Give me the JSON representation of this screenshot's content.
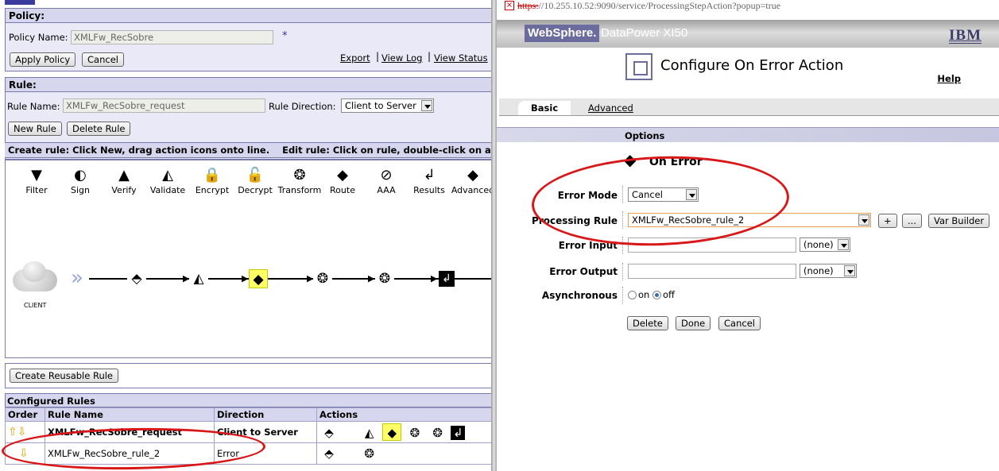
{
  "popup": {
    "url_strike": "https:",
    "url_rest": "//10.255.10.52:9090/service/ProcessingStepAction?popup=true",
    "brand_websphere": "WebSphere.",
    "brand_product": "DataPower XI50",
    "brand_ibm": "IBM",
    "title": "Configure On Error Action",
    "help": "Help",
    "tab_basic": "Basic",
    "tab_advanced": "Advanced",
    "options_header": "Options",
    "action_name": "On Error",
    "error_mode_label": "Error Mode",
    "error_mode_value": "Cancel",
    "processing_rule_label": "Processing Rule",
    "processing_rule_value": "XMLFw_RecSobre_rule_2",
    "plus_label": "+",
    "ellipsis_label": "...",
    "var_builder_label": "Var Builder",
    "error_input_label": "Error Input",
    "error_input_value": "",
    "error_input_context": "(none)",
    "error_output_label": "Error Output",
    "error_output_value": "",
    "error_output_context": "(none)",
    "asynchronous_label": "Asynchronous",
    "async_on": "on",
    "async_off": "off",
    "async_selected": "off",
    "delete": "Delete",
    "done": "Done",
    "cancel": "Cancel"
  },
  "policy": {
    "header": "Policy:",
    "name_label": "Policy Name:",
    "name_value": "XMLFw_RecSobre",
    "required_mark": "*",
    "apply": "Apply Policy",
    "cancel": "Cancel",
    "export": "Export",
    "view_log": "View Log",
    "view_status": "View Status"
  },
  "rule": {
    "header": "Rule:",
    "name_label": "Rule Name:",
    "name_value": "XMLFw_RecSobre_request",
    "direction_label": "Rule Direction:",
    "direction_value": "Client to Server",
    "new_rule": "New Rule",
    "delete_rule": "Delete Rule",
    "instructions": "Create rule: Click New, drag action icons onto line.    Edit rule: Click on rule, double-click on a"
  },
  "palette": [
    {
      "label": "Filter",
      "icon": "filter-icon",
      "glyph": "▼"
    },
    {
      "label": "Sign",
      "icon": "sign-icon",
      "glyph": "◐"
    },
    {
      "label": "Verify",
      "icon": "verify-icon",
      "glyph": "▲"
    },
    {
      "label": "Validate",
      "icon": "validate-icon",
      "glyph": "◭"
    },
    {
      "label": "Encrypt",
      "icon": "encrypt-icon",
      "glyph": "🔒"
    },
    {
      "label": "Decrypt",
      "icon": "decrypt-icon",
      "glyph": "🔓"
    },
    {
      "label": "Transform",
      "icon": "transform-icon",
      "glyph": "❂"
    },
    {
      "label": "Route",
      "icon": "route-icon",
      "glyph": "◆"
    },
    {
      "label": "AAA",
      "icon": "aaa-icon",
      "glyph": "⊘"
    },
    {
      "label": "Results",
      "icon": "results-icon",
      "glyph": "↲"
    },
    {
      "label": "Advanced",
      "icon": "advanced-icon",
      "glyph": "◆"
    }
  ],
  "client_label": "CLIENT",
  "reusable_rule": "Create Reusable Rule",
  "configured": {
    "header": "Configured Rules",
    "columns": [
      "Order",
      "Rule Name",
      "Direction",
      "Actions"
    ],
    "rows": [
      {
        "name": "XMLFw_RecSobre_request",
        "direction": "Client to Server"
      },
      {
        "name": "XMLFw_RecSobre_rule_2",
        "direction": "Error"
      }
    ]
  },
  "colors": {
    "highlight": "#ffff66",
    "annotation": "#d81818",
    "brand": "#6b6b9e"
  }
}
